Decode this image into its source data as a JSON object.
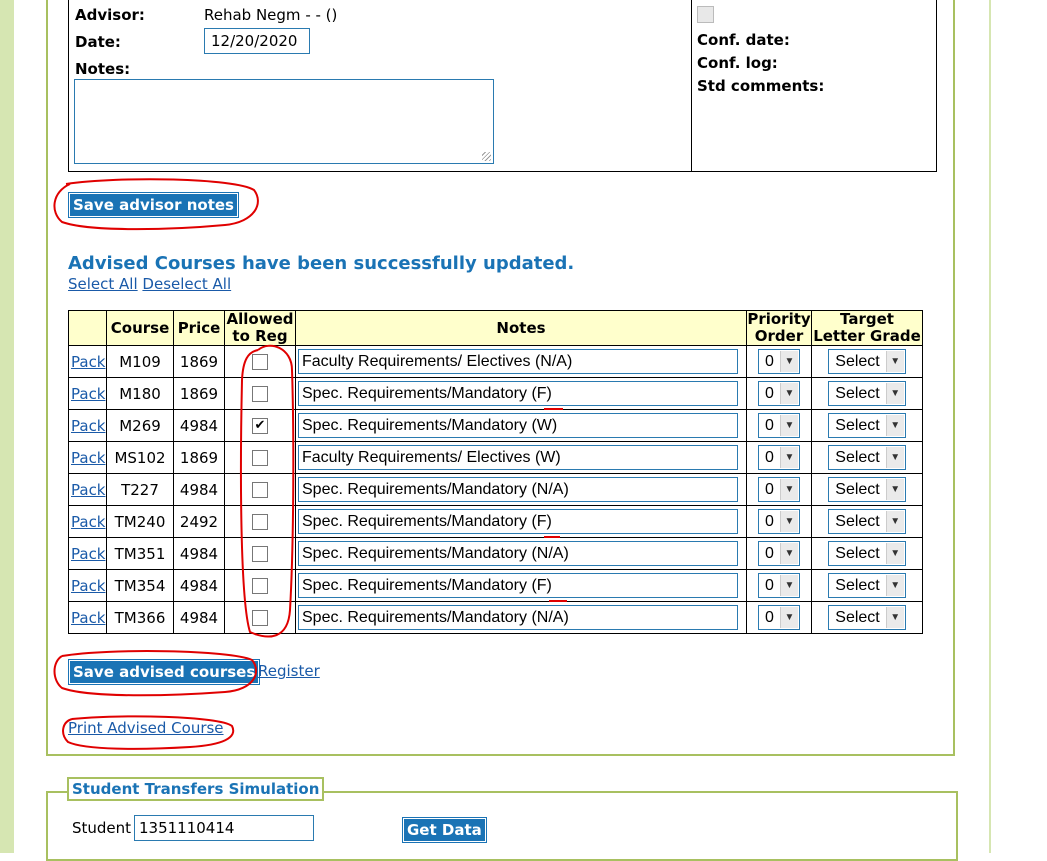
{
  "advisor": {
    "advisor_label": "Advisor:",
    "advisor_value": "Rehab Negm - - ()",
    "date_label": "Date:",
    "date_value": "12/20/2020",
    "notes_label": "Notes:",
    "notes_value": "",
    "conf_date_label": "Conf. date:",
    "conf_log_label": "Conf. log:",
    "std_comments_label": "Std comments:",
    "save_label": "Save advisor notes"
  },
  "advised": {
    "success_message": "Advised Courses have been successfully updated.",
    "select_all": "Select All",
    "deselect_all": "Deselect All",
    "headers": {
      "course": "Course",
      "price": "Price",
      "allowed": "Allowed to Reg",
      "notes": "Notes",
      "priority": "Priority Order",
      "target": "Target Letter Grade"
    },
    "rows": [
      {
        "link": "Pack",
        "course": "M109",
        "price": "1869",
        "allowed": false,
        "notes": "Faculty Requirements/ Electives (N/A)",
        "priority": "0",
        "target": "Select"
      },
      {
        "link": "Pack",
        "course": "M180",
        "price": "1869",
        "allowed": false,
        "notes": "Spec. Requirements/Mandatory (F)",
        "priority": "0",
        "target": "Select"
      },
      {
        "link": "Pack",
        "course": "M269",
        "price": "4984",
        "allowed": true,
        "notes": "Spec. Requirements/Mandatory (W)",
        "priority": "0",
        "target": "Select"
      },
      {
        "link": "Pack",
        "course": "MS102",
        "price": "1869",
        "allowed": false,
        "notes": "Faculty Requirements/ Electives (W)",
        "priority": "0",
        "target": "Select"
      },
      {
        "link": "Pack",
        "course": "T227",
        "price": "4984",
        "allowed": false,
        "notes": "Spec. Requirements/Mandatory (N/A)",
        "priority": "0",
        "target": "Select"
      },
      {
        "link": "Pack",
        "course": "TM240",
        "price": "2492",
        "allowed": false,
        "notes": "Spec. Requirements/Mandatory (F)",
        "priority": "0",
        "target": "Select"
      },
      {
        "link": "Pack",
        "course": "TM351",
        "price": "4984",
        "allowed": false,
        "notes": "Spec. Requirements/Mandatory (N/A)",
        "priority": "0",
        "target": "Select"
      },
      {
        "link": "Pack",
        "course": "TM354",
        "price": "4984",
        "allowed": false,
        "notes": "Spec. Requirements/Mandatory (F)",
        "priority": "0",
        "target": "Select"
      },
      {
        "link": "Pack",
        "course": "TM366",
        "price": "4984",
        "allowed": false,
        "notes": "Spec. Requirements/Mandatory (N/A)",
        "priority": "0",
        "target": "Select"
      }
    ],
    "save_label": "Save advised courses",
    "register_label": "Register",
    "print_label": "Print Advised Course"
  },
  "transfers": {
    "title": "Student Transfers Simulation",
    "student_label": "Student",
    "student_value": "1351110414",
    "get_data_label": "Get Data"
  },
  "colors": {
    "accent": "#1a73b5",
    "header_bg": "#ffffcc",
    "panel_border": "#a8c060",
    "annotation": "#e00000"
  }
}
